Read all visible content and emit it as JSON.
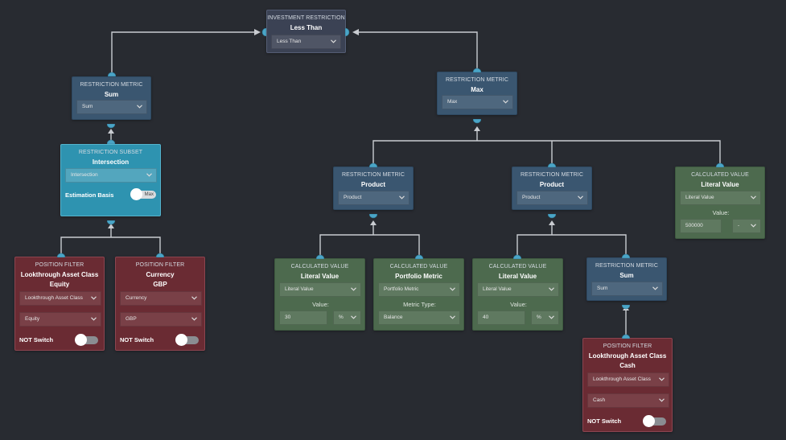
{
  "nodes": {
    "investment": {
      "type": "INVESTMENT RESTRICTION",
      "title": "Less Than",
      "select": "Less Than"
    },
    "sum_top": {
      "type": "RESTRICTION METRIC",
      "title": "Sum",
      "select": "Sum"
    },
    "max": {
      "type": "RESTRICTION METRIC",
      "title": "Max",
      "select": "Max"
    },
    "subset": {
      "type": "RESTRICTION SUBSET",
      "title": "Intersection",
      "select": "Intersection",
      "toggle_label": "Estimation Basis",
      "toggle_value": "Max"
    },
    "pf_equity": {
      "type": "POSITION FILTER",
      "title1": "Lookthrough Asset Class",
      "title2": "Equity",
      "select1": "Lookthrough Asset Class",
      "select2": "Equity",
      "switch_label": "NOT Switch"
    },
    "pf_gbp": {
      "type": "POSITION FILTER",
      "title1": "Currency",
      "title2": "GBP",
      "select1": "Currency",
      "select2": "GBP",
      "switch_label": "NOT Switch"
    },
    "product1": {
      "type": "RESTRICTION METRIC",
      "title": "Product",
      "select": "Product"
    },
    "product2": {
      "type": "RESTRICTION METRIC",
      "title": "Product",
      "select": "Product"
    },
    "calc_top": {
      "type": "CALCULATED VALUE",
      "title": "Literal Value",
      "select": "Literal Value",
      "value_label": "Value:",
      "value": "500000",
      "unit": "-"
    },
    "calc30": {
      "type": "CALCULATED VALUE",
      "title": "Literal Value",
      "select": "Literal Value",
      "value_label": "Value:",
      "value": "30",
      "unit": "%"
    },
    "portfolio": {
      "type": "CALCULATED VALUE",
      "title": "Portfolio Metric",
      "select": "Portfolio Metric",
      "metric_label": "Metric Type:",
      "metric": "Balance"
    },
    "calc40": {
      "type": "CALCULATED VALUE",
      "title": "Literal Value",
      "select": "Literal Value",
      "value_label": "Value:",
      "value": "40",
      "unit": "%"
    },
    "sum2": {
      "type": "RESTRICTION METRIC",
      "title": "Sum",
      "select": "Sum"
    },
    "pf_cash": {
      "type": "POSITION FILTER",
      "title1": "Lookthrough Asset Class",
      "title2": "Cash",
      "select1": "Lookthrough Asset Class",
      "select2": "Cash",
      "switch_label": "NOT Switch"
    }
  },
  "colors": {
    "background": "#282b31",
    "restriction_metric": "#3a5670",
    "investment_restriction": "#3b4254",
    "restriction_subset": "#2e93b0",
    "position_filter": "#6a2b33",
    "calculated_value": "#4d6a4e",
    "port": "#4aa5c7",
    "edge": "#c9ccd1"
  },
  "icons": [
    "chevron-down-icon",
    "port-icon",
    "arrow-head-icon",
    "toggle-switch"
  ]
}
